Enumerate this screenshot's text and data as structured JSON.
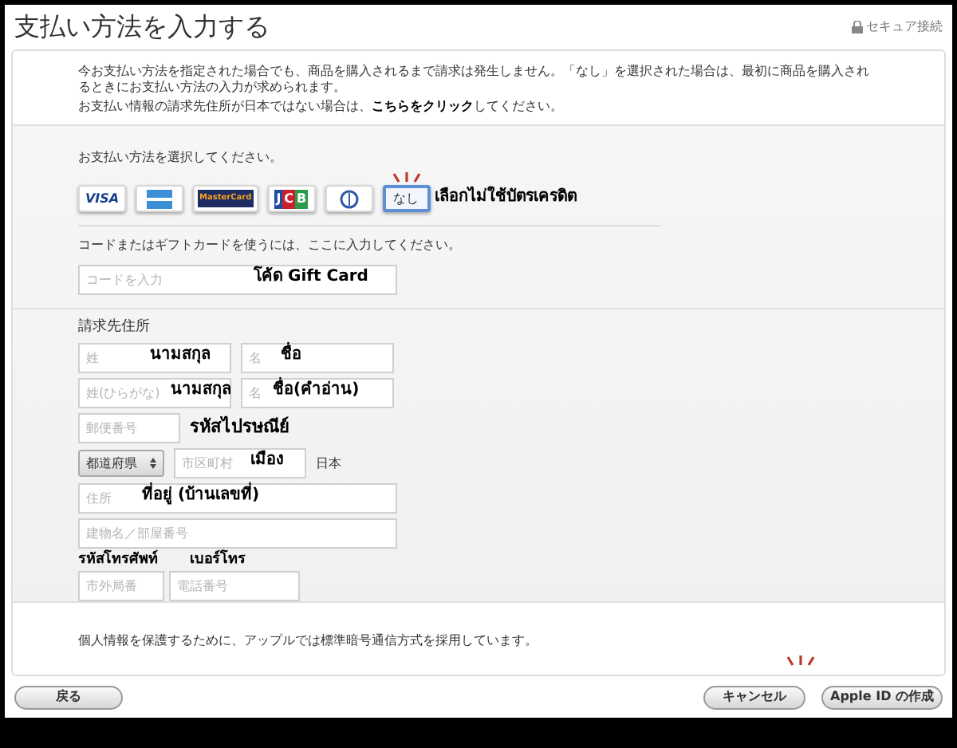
{
  "header": {
    "title": "支払い方法を入力する",
    "secure": "セキュア接続"
  },
  "intro": {
    "text": "今お支払い方法を指定された場合でも、商品を購入されるまで請求は発生しません。「なし」を選択された場合は、最初に商品を購入されるときにお支払い方法の入力が求められます。",
    "before": "お支払い情報の請求先住所が日本ではない場合は、",
    "link": "こちらをクリック",
    "after": "してください。"
  },
  "payment": {
    "label": "お支払い方法を選択してください。",
    "note": "เลือกไม่ใช้บัตรเครดิต",
    "cards": [
      {
        "kind": "visa",
        "text": "VISA",
        "selected": false
      },
      {
        "kind": "amex",
        "selected": false
      },
      {
        "kind": "mastercard",
        "text": "MasterCard",
        "selected": false
      },
      {
        "kind": "jcb",
        "text": "JCB",
        "selected": false
      },
      {
        "kind": "diners",
        "selected": false
      },
      {
        "kind": "none",
        "text": "なし",
        "selected": true
      }
    ]
  },
  "gift": {
    "label": "コードまたはギフトカードを使うには、ここに入力してください。",
    "placeholder": "コードを入力",
    "note": "โค้ด Gift Card"
  },
  "billing": {
    "heading": "請求先住所",
    "last_name": {
      "placeholder": "姓",
      "note": "นามสกุล"
    },
    "first_name": {
      "placeholder": "名",
      "note": "ชื่อ"
    },
    "last_name_kana": {
      "placeholder": "姓(ひらがな)",
      "note": "นามสกุล"
    },
    "first_name_kana": {
      "placeholder": "名",
      "note": "ชื่อ(คำอ่าน)"
    },
    "postal_code": {
      "placeholder": "郵便番号",
      "note": "รหัสไปรษณีย์"
    },
    "prefecture": {
      "value": "都道府県"
    },
    "city": {
      "placeholder": "市区町村",
      "note": "เมือง"
    },
    "country": "日本",
    "address": {
      "placeholder": "住所",
      "note": "ที่อยู่ (บ้านเลขที่)"
    },
    "building": {
      "placeholder": "建物名／部屋番号"
    },
    "area_code": {
      "placeholder": "市外局番",
      "note": "รหัสโทรศัพท์"
    },
    "phone": {
      "placeholder": "電話番号",
      "note": "เบอร์โทร"
    }
  },
  "footer_note": "個人情報を保護するために、アップルでは標準暗号通信方式を採用しています。",
  "buttons": {
    "back": "戻る",
    "cancel": "キャンセル",
    "create": "Apple ID の作成"
  }
}
